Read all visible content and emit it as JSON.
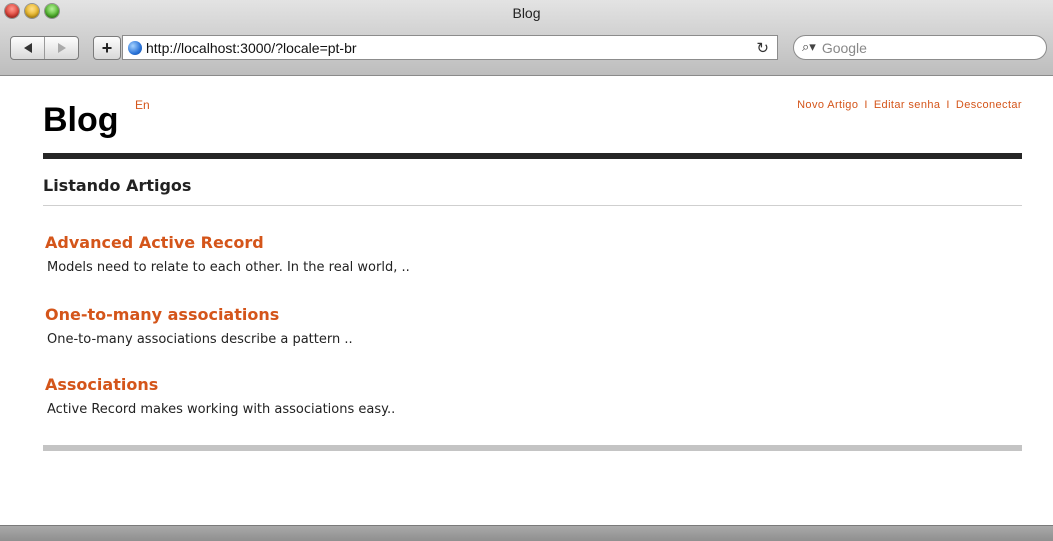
{
  "window": {
    "title": "Blog"
  },
  "toolbar": {
    "url": "http://localhost:3000/?locale=pt-br",
    "search_placeholder": "Google"
  },
  "site": {
    "logo": "Blog",
    "locale_link": "En",
    "nav": [
      {
        "label": "Novo Artigo"
      },
      {
        "label": "Editar senha"
      },
      {
        "label": "Desconectar"
      }
    ],
    "nav_separator": "I"
  },
  "main": {
    "title": "Listando Artigos",
    "articles": [
      {
        "title": "Advanced Active Record",
        "excerpt": "Models need to relate to each other. In the real world, .."
      },
      {
        "title": "One-to-many associations",
        "excerpt": "One-to-many associations describe a pattern .."
      },
      {
        "title": "Associations",
        "excerpt": "Active Record makes working with associations easy.."
      }
    ]
  },
  "colors": {
    "accent": "#d4551a",
    "header_rule": "#262626"
  }
}
